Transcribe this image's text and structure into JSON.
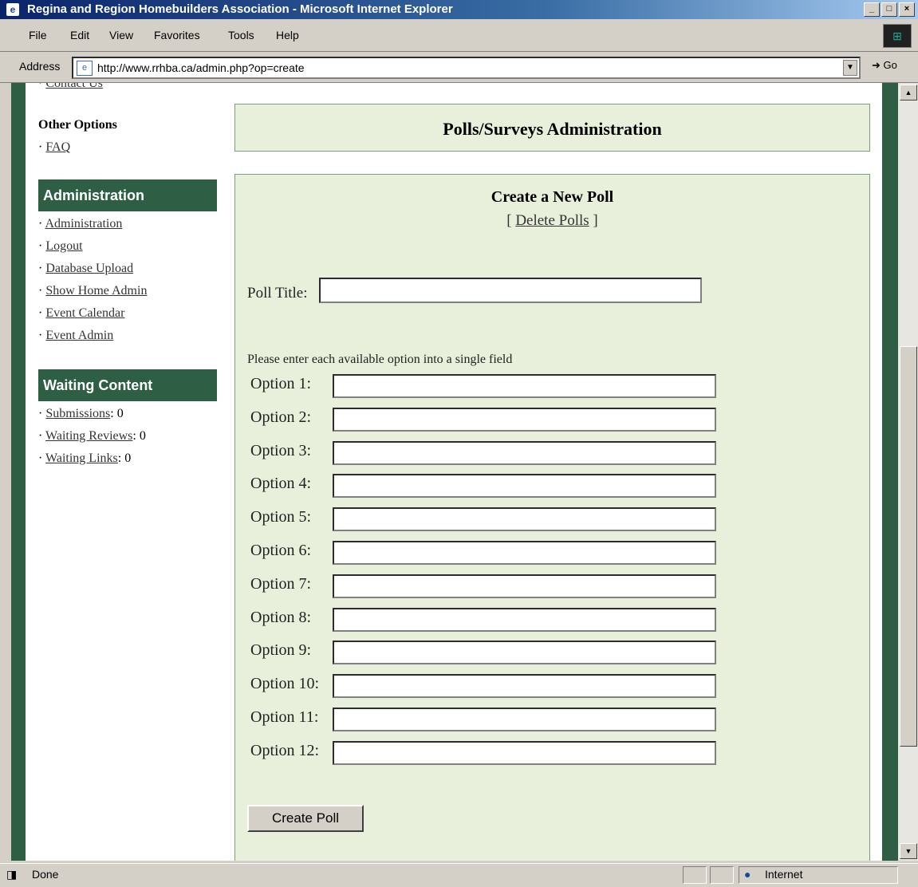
{
  "window": {
    "title": "Regina and Region Homebuilders Association - Microsoft Internet Explorer"
  },
  "menu": [
    "File",
    "Edit",
    "View",
    "Favorites",
    "Tools",
    "Help"
  ],
  "address": {
    "label": "Address",
    "url": "http://www.rrhba.ca/admin.php?op=create",
    "go": "Go"
  },
  "sidebar": {
    "top_link": "Contact Us",
    "other_heading": "Other Options",
    "other_links": [
      "FAQ"
    ],
    "admin_heading": "Administration",
    "admin_links": [
      "Administration",
      "Logout",
      "Database Upload",
      "Show Home Admin",
      "Event Calendar",
      "Event Admin"
    ],
    "waiting_heading": "Waiting Content",
    "waiting": [
      {
        "label": "Submissions",
        "count": ": 0"
      },
      {
        "label": "Waiting Reviews",
        "count": ": 0"
      },
      {
        "label": "Waiting Links",
        "count": ": 0"
      }
    ]
  },
  "main": {
    "header": "Polls/Surveys Administration",
    "form_title": "Create a New Poll",
    "delete_open": "[",
    "delete_link": "Delete Polls",
    "delete_close": "]",
    "poll_title_label": "Poll Title:",
    "instructions": "Please enter each available option into a single field",
    "options": [
      "Option 1:",
      "Option 2:",
      "Option 3:",
      "Option 4:",
      "Option 5:",
      "Option 6:",
      "Option 7:",
      "Option 8:",
      "Option 9:",
      "Option 10:",
      "Option 11:",
      "Option 12:"
    ],
    "submit": "Create Poll"
  },
  "status": {
    "text": "Done",
    "zone": "Internet"
  }
}
